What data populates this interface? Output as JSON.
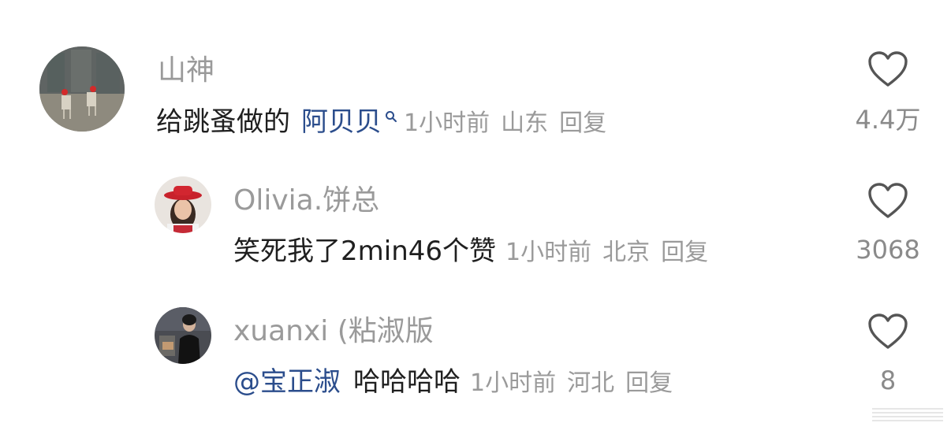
{
  "comments": [
    {
      "username": "山神",
      "text": "给跳蚤做的",
      "mention": "阿贝贝",
      "time": "1小时前",
      "location": "山东",
      "reply_label": "回复",
      "like_count": "4.4万",
      "avatar_icon": "avatar-stone-wall-chairs"
    },
    {
      "username": "Olivia.饼总",
      "text": "笑死我了2min46个赞",
      "time": "1小时前",
      "location": "北京",
      "reply_label": "回复",
      "like_count": "3068",
      "avatar_icon": "avatar-girl-red-hat"
    },
    {
      "username": "xuanxi (粘淑版",
      "mention": "@宝正淑",
      "text": "哈哈哈哈",
      "time": "1小时前",
      "location": "河北",
      "reply_label": "回复",
      "like_count": "8",
      "avatar_icon": "avatar-person-dark"
    }
  ],
  "colors": {
    "text": "#1f1f1f",
    "meta": "#9a9a9a",
    "mention": "#2b4d8c"
  }
}
